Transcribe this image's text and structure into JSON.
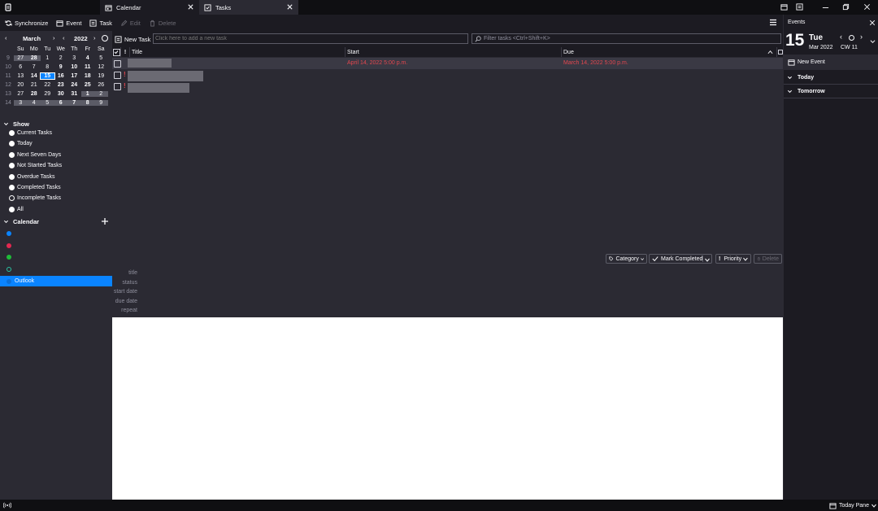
{
  "tabs": [
    {
      "label": "Calendar"
    },
    {
      "label": "Tasks"
    }
  ],
  "toolbar": {
    "synchronize": "Synchronize",
    "event": "Event",
    "task": "Task",
    "edit": "Edit",
    "delete": "Delete"
  },
  "minimonth": {
    "month": "March",
    "year": "2022",
    "weekdays": [
      "Su",
      "Mo",
      "Tu",
      "We",
      "Th",
      "Fr",
      "Sa"
    ],
    "weeks": [
      {
        "wk": "9",
        "days": [
          "27",
          "28",
          "1",
          "2",
          "3",
          "4",
          "5"
        ]
      },
      {
        "wk": "10",
        "days": [
          "6",
          "7",
          "8",
          "9",
          "10",
          "11",
          "12"
        ]
      },
      {
        "wk": "11",
        "days": [
          "13",
          "14",
          "15",
          "16",
          "17",
          "18",
          "19"
        ]
      },
      {
        "wk": "12",
        "days": [
          "20",
          "21",
          "22",
          "23",
          "24",
          "25",
          "26"
        ]
      },
      {
        "wk": "13",
        "days": [
          "27",
          "28",
          "29",
          "30",
          "31",
          "1",
          "2"
        ]
      },
      {
        "wk": "14",
        "days": [
          "3",
          "4",
          "5",
          "6",
          "7",
          "8",
          "9"
        ]
      }
    ]
  },
  "show": {
    "title": "Show",
    "filters": [
      "Current Tasks",
      "Today",
      "Next Seven Days",
      "Not Started Tasks",
      "Overdue Tasks",
      "Completed Tasks",
      "Incomplete Tasks",
      "All"
    ]
  },
  "calendars": {
    "title": "Calendar",
    "selected_label": "Outlook",
    "colors": [
      "#0a84ff",
      "#e22850",
      "#2ac3a2",
      "#1fbb38"
    ]
  },
  "newtask": {
    "button": "New Task",
    "placeholder": "Click here to add a new task",
    "filter_placeholder": "Filter tasks <Ctrl+Shift+K>"
  },
  "columns": {
    "title": "Title",
    "start": "Start",
    "due": "Due",
    "priority": "!"
  },
  "tasks": [
    {
      "start": "April 14, 2022 5:00 p.m.",
      "due": "March 14, 2022 5:00 p.m."
    }
  ],
  "details": {
    "labels": [
      "title",
      "status",
      "start date",
      "due date",
      "repeat"
    ],
    "category": "Category",
    "mark_completed": "Mark Completed",
    "priority": "Priority",
    "delete": "Delete"
  },
  "today_pane": {
    "header": "Events",
    "day_number": "15",
    "weekday": "Tue",
    "month_year": "Mar 2022",
    "cw": "CW 11",
    "new_event": "New Event",
    "today": "Today",
    "tomorrow": "Tomorrow",
    "status_label": "Today Pane"
  }
}
